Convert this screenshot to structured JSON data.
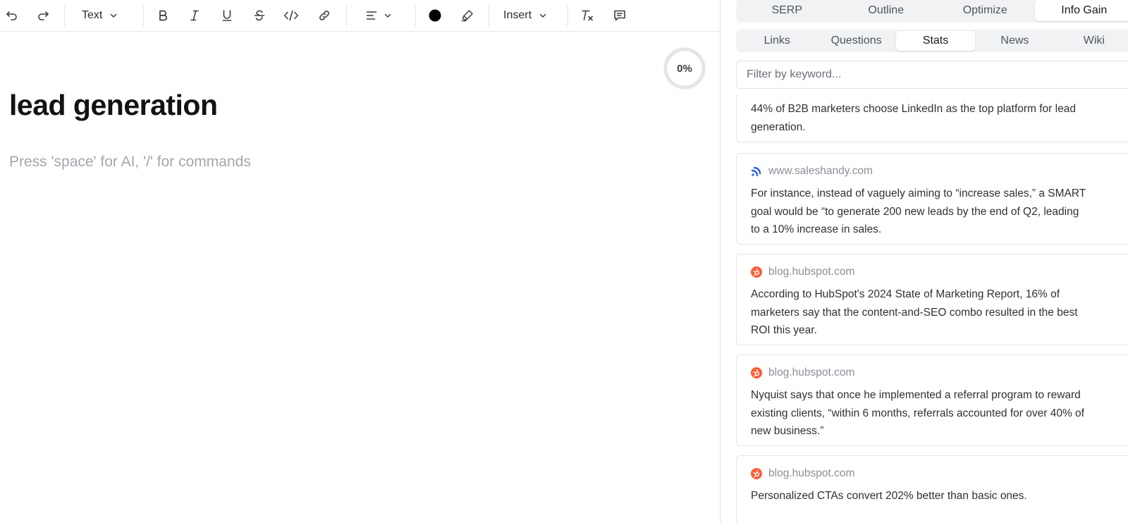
{
  "toolbar": {
    "text_dropdown_label": "Text",
    "insert_dropdown_label": "Insert",
    "icons": [
      "undo-icon",
      "redo-icon",
      "bold-icon",
      "italic-icon",
      "underline-icon",
      "strikethrough-icon",
      "code-icon",
      "link-icon",
      "align-icon",
      "text-color-icon",
      "highlight-icon",
      "clear-format-icon",
      "comment-icon"
    ],
    "text_color": "#000000"
  },
  "editor": {
    "progress": "0%",
    "progress_value": 0,
    "title": "lead generation",
    "placeholder": "Press 'space' for AI, '/' for commands"
  },
  "panel": {
    "main_tabs": [
      {
        "label": "SERP",
        "active": false
      },
      {
        "label": "Outline",
        "active": false
      },
      {
        "label": "Optimize",
        "active": false
      },
      {
        "label": "Info Gain",
        "active": true
      }
    ],
    "sub_tabs": [
      {
        "label": "Links",
        "active": false
      },
      {
        "label": "Questions",
        "active": false
      },
      {
        "label": "Stats",
        "active": true
      },
      {
        "label": "News",
        "active": false
      },
      {
        "label": "Wiki",
        "active": false
      }
    ],
    "filter_placeholder": "Filter by keyword...",
    "stats": [
      {
        "source": "",
        "text": "44% of B2B marketers choose LinkedIn as the top platform for lead generation."
      },
      {
        "source": "www.saleshandy.com",
        "icon": "saleshandy-icon",
        "text": "For instance, instead of vaguely aiming to “increase sales,” a SMART goal would be “to generate 200 new leads by the end of Q2, leading to a 10% increase in sales."
      },
      {
        "source": "blog.hubspot.com",
        "icon": "hubspot-icon",
        "text": "According to HubSpot's 2024 State of Marketing Report, 16% of marketers say that the content-and-SEO combo resulted in the best ROI this year."
      },
      {
        "source": "blog.hubspot.com",
        "icon": "hubspot-icon",
        "text": "Nyquist says that once he implemented a referral program to reward existing clients, “within 6 months, referrals accounted for over 40% of new business.”"
      },
      {
        "source": "blog.hubspot.com",
        "icon": "hubspot-icon",
        "text": "Personalized CTAs convert 202% better than basic ones."
      }
    ],
    "colors": {
      "hubspot": "#ff5c35",
      "saleshandy": "#2e5ce6"
    }
  }
}
